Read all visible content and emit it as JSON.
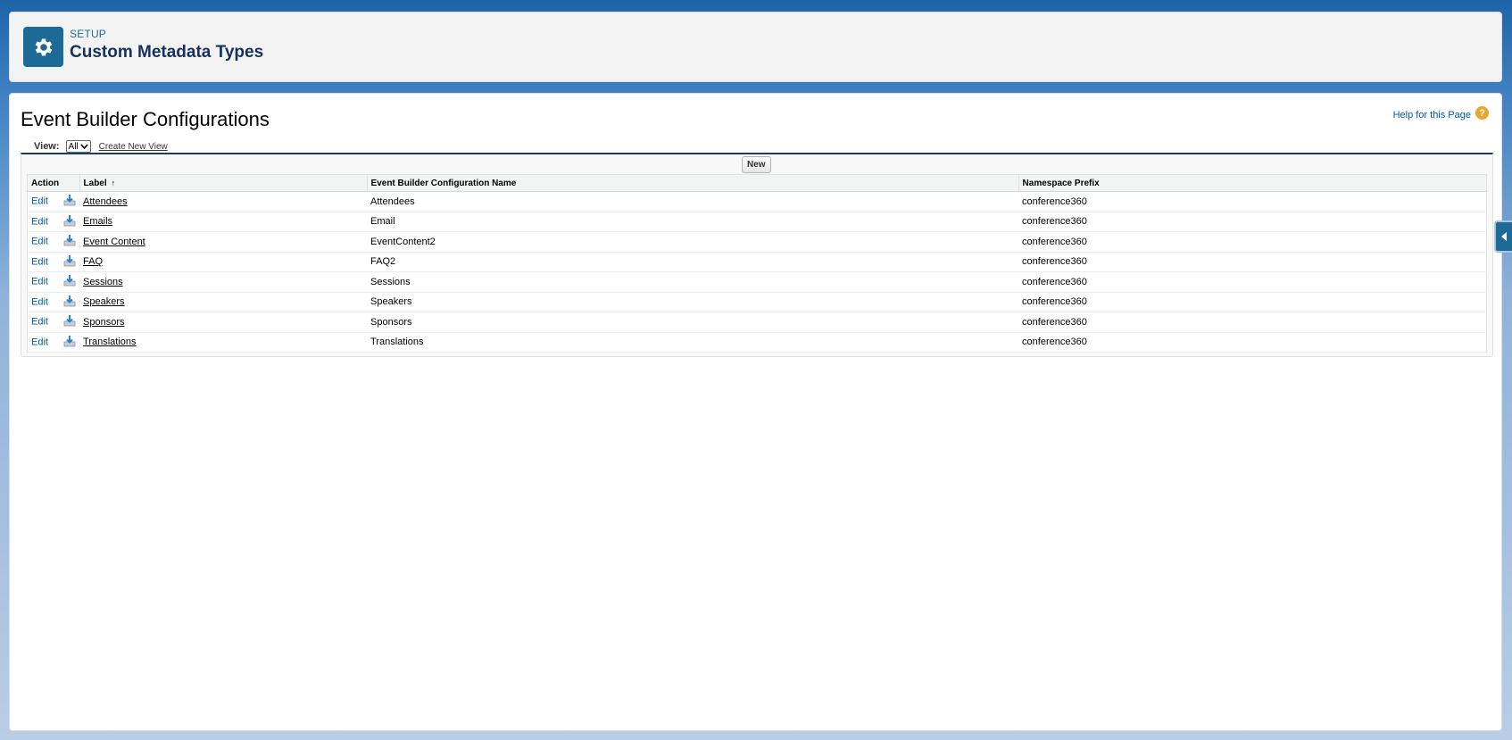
{
  "header": {
    "eyebrow": "SETUP",
    "title": "Custom Metadata Types",
    "icon": "gear-icon"
  },
  "page": {
    "title": "Event Builder Configurations",
    "help_label": "Help for this Page",
    "help_glyph": "?"
  },
  "view": {
    "label": "View:",
    "selected": "All",
    "create_link": "Create New View"
  },
  "toolbar": {
    "new_label": "New"
  },
  "table": {
    "columns": [
      "Action",
      "Label",
      "Event Builder Configuration Name",
      "Namespace Prefix"
    ],
    "sort_indicator": "↑",
    "edit_label": "Edit",
    "rows": [
      {
        "label": "Attendees",
        "name": "Attendees",
        "prefix": "conference360"
      },
      {
        "label": "Emails",
        "name": "Email",
        "prefix": "conference360"
      },
      {
        "label": "Event Content",
        "name": "EventContent2",
        "prefix": "conference360"
      },
      {
        "label": "FAQ",
        "name": "FAQ2",
        "prefix": "conference360"
      },
      {
        "label": "Sessions",
        "name": "Sessions",
        "prefix": "conference360"
      },
      {
        "label": "Speakers",
        "name": "Speakers",
        "prefix": "conference360"
      },
      {
        "label": "Sponsors",
        "name": "Sponsors",
        "prefix": "conference360"
      },
      {
        "label": "Translations",
        "name": "Translations",
        "prefix": "conference360"
      }
    ]
  },
  "colors": {
    "brand": "#1b6b96",
    "link": "#015ba7",
    "help_icon": "#e8a72b"
  }
}
